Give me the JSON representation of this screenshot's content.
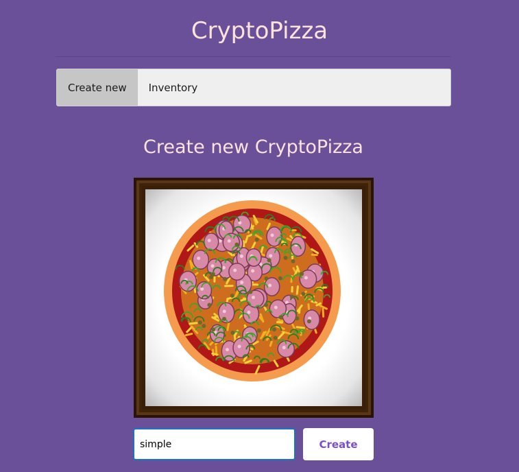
{
  "app": {
    "title": "CryptoPizza"
  },
  "nav": {
    "tabs": [
      {
        "label": "Create new",
        "active": true
      },
      {
        "label": "Inventory",
        "active": false
      }
    ]
  },
  "create": {
    "heading": "Create new CryptoPizza",
    "name_input": {
      "value": "simple"
    },
    "create_button_label": "Create"
  },
  "colors": {
    "background": "#6a4f99",
    "title_text": "#fbe3da",
    "frame": "#3a1f08",
    "button_text": "#7a4fc9",
    "input_focus_border": "#1b73c7"
  },
  "pizza": {
    "toppings": [
      "tomato sauce",
      "cheese",
      "salami",
      "green peppers",
      "olives"
    ]
  }
}
